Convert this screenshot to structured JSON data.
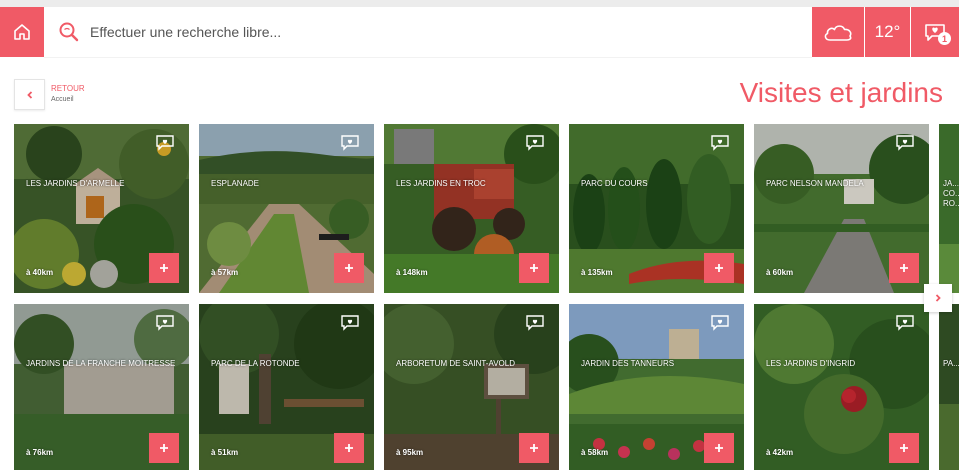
{
  "search": {
    "placeholder": "Effectuer une recherche libre..."
  },
  "weather": {
    "temperature": "12°",
    "favorites_count": "1"
  },
  "back": {
    "label": "RETOUR",
    "sublabel": "Accueil"
  },
  "page": {
    "title": "Visites et jardins"
  },
  "colors": {
    "accent": "#f05a66"
  },
  "icons": {
    "home": "home-icon",
    "search": "search-icon",
    "weather": "cloud-icon",
    "favorites": "heart-chat-icon",
    "back": "chevron-left-icon",
    "next": "chevron-right-icon",
    "add": "plus-icon"
  },
  "cards": [
    {
      "name": "LES JARDINS D'ARMELLE",
      "distance": "à 40km"
    },
    {
      "name": "ESPLANADE",
      "distance": "à 57km"
    },
    {
      "name": "LES JARDINS EN TROC",
      "distance": "à 148km"
    },
    {
      "name": "PARC DU COURS",
      "distance": "à 135km"
    },
    {
      "name": "PARC NELSON MANDELA",
      "distance": "à 60km"
    },
    {
      "name": "JA... CO... RO...",
      "distance": ""
    },
    {
      "name": "JARDINS DE LA FRANCHE MOITRESSE",
      "distance": "à 76km"
    },
    {
      "name": "PARC DE LA ROTONDE",
      "distance": "à 51km"
    },
    {
      "name": "ARBORETUM DE SAINT-AVOLD",
      "distance": "à 95km"
    },
    {
      "name": "JARDIN DES TANNEURS",
      "distance": "à 58km"
    },
    {
      "name": "LES JARDINS D'INGRID",
      "distance": "à 42km"
    },
    {
      "name": "PA...",
      "distance": ""
    }
  ]
}
